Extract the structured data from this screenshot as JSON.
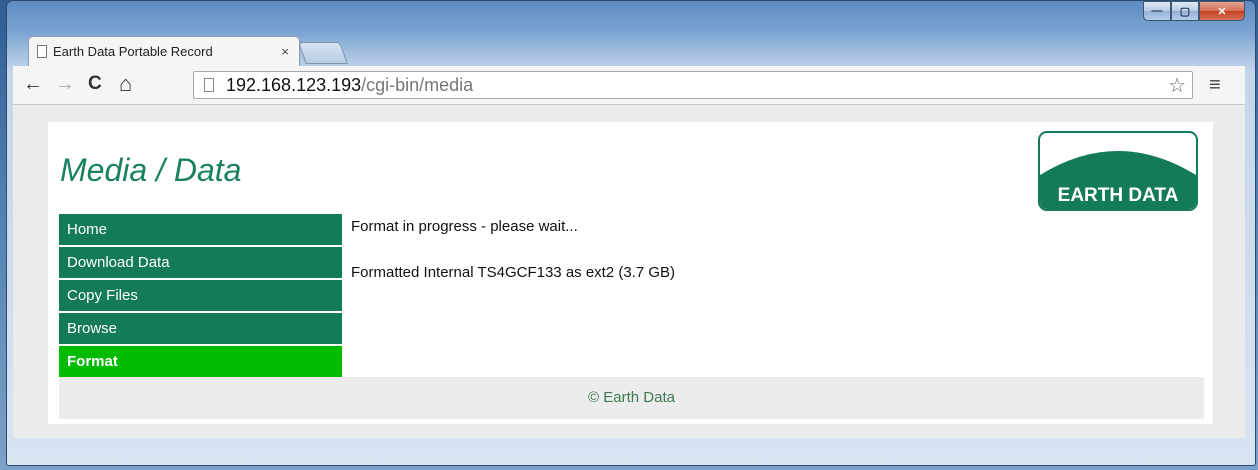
{
  "browser": {
    "tab_title": "Earth Data Portable Record",
    "tab_close": "×",
    "url_host": "192.168.123.193",
    "url_path": "/cgi-bin/media",
    "back": "←",
    "forward": "→",
    "reload": "C",
    "home": "⌂",
    "star": "☆",
    "menu": "≡",
    "window_buttons": {
      "min": "—",
      "max": "▢",
      "close": "✕"
    }
  },
  "page": {
    "title": "Media / Data",
    "logo_text": "EARTH DATA",
    "brand_color": "#137a5a",
    "active_color": "#00bb00",
    "menu": [
      {
        "label": "Home",
        "active": false
      },
      {
        "label": "Download Data",
        "active": false
      },
      {
        "label": "Copy Files",
        "active": false
      },
      {
        "label": "Browse",
        "active": false
      },
      {
        "label": "Format",
        "active": true
      }
    ],
    "messages": [
      "Format in progress - please wait...",
      "Formatted Internal TS4GCF133 as ext2 (3.7 GB)"
    ],
    "footer": "© Earth Data"
  }
}
